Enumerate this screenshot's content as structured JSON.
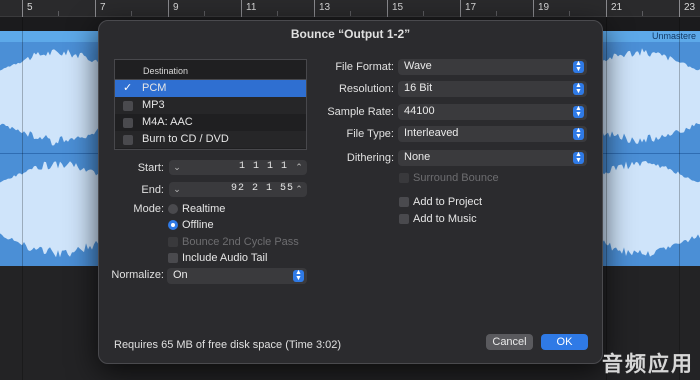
{
  "ruler": {
    "labels": [
      "5",
      "7",
      "9",
      "11",
      "13",
      "15",
      "17",
      "19",
      "21",
      "23"
    ]
  },
  "track": {
    "region_label": "Unmastere",
    "color": "#4b8fd6"
  },
  "dialog": {
    "title": "Bounce “Output 1-2”",
    "destination": {
      "header": "Destination",
      "items": [
        {
          "label": "PCM",
          "checked": true,
          "selected": true
        },
        {
          "label": "MP3",
          "checked": false
        },
        {
          "label": "M4A: AAC",
          "checked": false
        },
        {
          "label": "Burn to CD / DVD",
          "checked": false
        }
      ]
    },
    "start": {
      "label": "Start:",
      "value": "1  1  1     1"
    },
    "end": {
      "label": "End:",
      "value": "92  2  1    55"
    },
    "mode": {
      "label": "Mode:",
      "options": [
        {
          "label": "Realtime",
          "selected": false
        },
        {
          "label": "Offline",
          "selected": true
        }
      ]
    },
    "checkboxes": {
      "bounce_2nd_cycle": {
        "label": "Bounce 2nd Cycle Pass",
        "disabled": true
      },
      "include_audio_tail": {
        "label": "Include Audio Tail",
        "checked": false
      }
    },
    "normalize": {
      "label": "Normalize:",
      "value": "On"
    },
    "file_format": {
      "label": "File Format:",
      "value": "Wave"
    },
    "resolution": {
      "label": "Resolution:",
      "value": "16 Bit"
    },
    "sample_rate": {
      "label": "Sample Rate:",
      "value": "44100"
    },
    "file_type": {
      "label": "File Type:",
      "value": "Interleaved"
    },
    "dithering": {
      "label": "Dithering:",
      "value": "None"
    },
    "surround_bounce": {
      "label": "Surround Bounce",
      "disabled": true
    },
    "add_to_project": {
      "label": "Add to Project",
      "checked": false
    },
    "add_to_music": {
      "label": "Add to Music",
      "checked": false
    },
    "footer_text": "Requires 65 MB of free disk space  (Time 3:02)",
    "cancel_label": "Cancel",
    "ok_label": "OK",
    "accent_color": "#2f7ae6"
  },
  "watermark": "音频应用"
}
